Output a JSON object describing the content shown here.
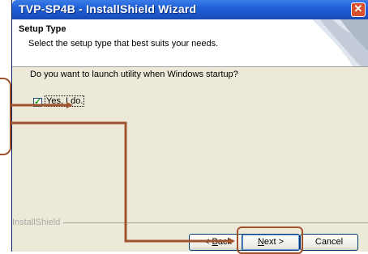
{
  "window": {
    "title": "TVP-SP4B - InstallShield Wizard",
    "close_glyph": "✕"
  },
  "header": {
    "title": "Setup Type",
    "description": "Select the setup type that best suits your needs."
  },
  "body": {
    "question": "Do you want to launch utility when Windows startup?",
    "checkbox_label": "Yes, I do.",
    "checkbox_checked": true
  },
  "footer": {
    "brand": "InstallShield",
    "back_label_prefix": "< ",
    "back_label_key": "B",
    "back_label_rest": "ack",
    "next_label_key": "N",
    "next_label_rest": "ext >",
    "cancel_label": "Cancel"
  },
  "colors": {
    "title_bar": "#1f5fd6",
    "dialog_bg": "#ece9d8",
    "annotation": "#a0522d"
  }
}
